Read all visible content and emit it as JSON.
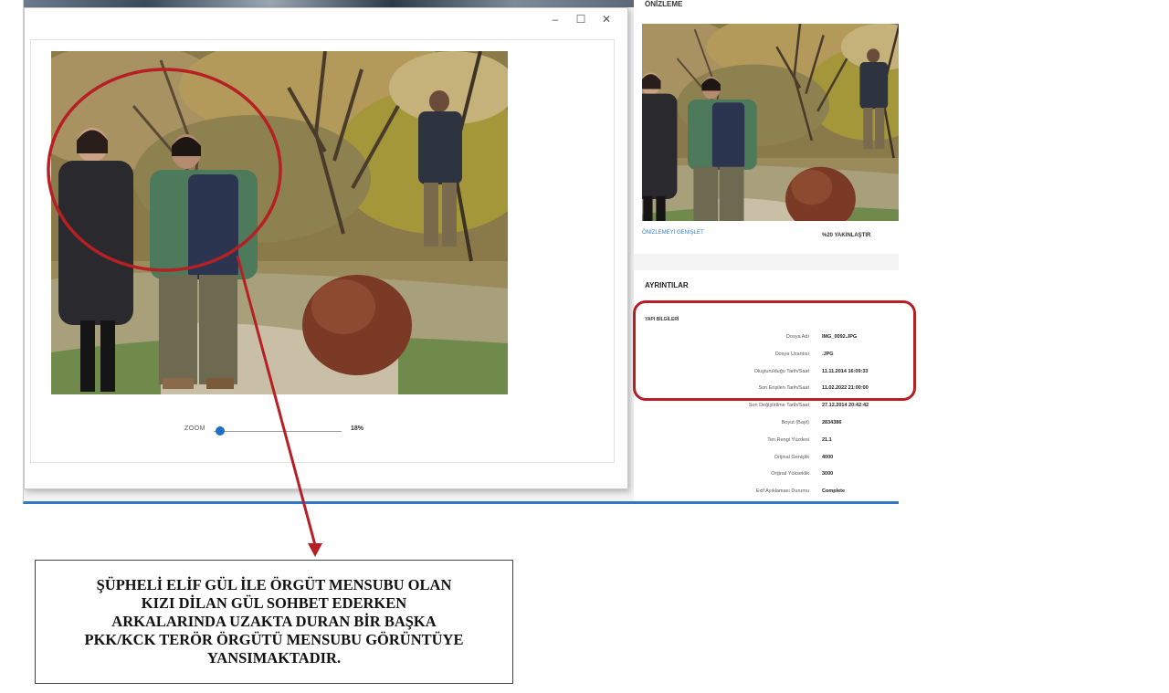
{
  "viewer": {
    "window_controls": {
      "minimize": "–",
      "maximize": "☐",
      "close": "✕"
    },
    "zoom_label": "ZOOM",
    "zoom_value": "18%",
    "zoom_fraction": 0.05
  },
  "preview": {
    "heading": "ÖNİZLEME",
    "expand_link": "ÖNİZLEMEYİ GENİŞLET",
    "zoom_action": "%20 YAKINLAŞTIR"
  },
  "details": {
    "heading": "AYRINTILAR",
    "group": "YAPI BİLGİLERİ",
    "rows": [
      {
        "label": "Dosya Adı",
        "value": "IMG_0092.JPG"
      },
      {
        "label": "Dosya Uzantısı",
        "value": ".JPG"
      },
      {
        "label": "Oluşturulduğu Tarih/Saat",
        "value": "11.11.2014 16:09:33"
      },
      {
        "label": "Son Erişilen Tarih/Saat",
        "value": "11.02.2022 21:00:00"
      },
      {
        "label": "Son Değiştirilme Tarih/Saat",
        "value": "27.12.2014 20:42:42"
      },
      {
        "label": "Boyut (Bayt)",
        "value": "2834386"
      },
      {
        "label": "Ten Rengi Yüzdesi",
        "value": "21.1"
      },
      {
        "label": "Orijinal Genişlik",
        "value": "4000"
      },
      {
        "label": "Orijinal Yükseklik",
        "value": "3000"
      },
      {
        "label": "Exif Ayıklaması Durumu",
        "value": "Complete"
      }
    ]
  },
  "caption": {
    "lines": [
      "ŞÜPHELİ ELİF GÜL İLE ÖRGÜT MENSUBU OLAN",
      "KIZI DİLAN GÜL SOHBET EDERKEN",
      "ARKALARINDA UZAKTA DURAN BİR BAŞKA",
      "PKK/KCK TERÖR ÖRGÜTÜ MENSUBU GÖRÜNTÜYE",
      "YANSIMAKTADIR."
    ]
  },
  "colors": {
    "annotation_red": "#b61f24",
    "accent_blue": "#2f78c4",
    "slider_blue": "#1d6fc2"
  }
}
